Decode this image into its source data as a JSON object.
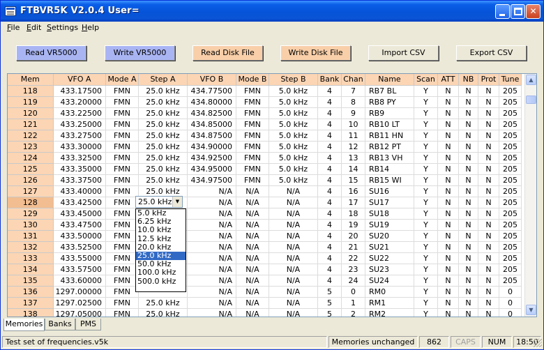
{
  "window": {
    "title": "FTBVR5K V2.0.4    User="
  },
  "menu": [
    {
      "pre": "",
      "u": "F",
      "post": "ile"
    },
    {
      "pre": "",
      "u": "E",
      "post": "dit"
    },
    {
      "pre": "",
      "u": "S",
      "post": "ettings"
    },
    {
      "pre": "",
      "u": "H",
      "post": "elp"
    }
  ],
  "toolbar": {
    "read_vr5000": "Read VR5000",
    "write_vr5000": "Write VR5000",
    "read_disk": "Read Disk File",
    "write_disk": "Write Disk File",
    "import_csv": "Import CSV",
    "export_csv": "Export CSV"
  },
  "grid": {
    "columns": [
      "Mem",
      "VFO A",
      "Mode A",
      "Step A",
      "VFO B",
      "Mode B",
      "Step B",
      "Bank",
      "Chan",
      "Name",
      "Scan",
      "ATT",
      "NB",
      "Prot",
      "Tune"
    ],
    "rows": [
      [
        "118",
        "433.17500",
        "FMN",
        "25.0 kHz",
        "434.77500",
        "FMN",
        "5.0 kHz",
        "4",
        "7",
        "RB7 BL",
        "Y",
        "N",
        "N",
        "N",
        "205"
      ],
      [
        "119",
        "433.20000",
        "FMN",
        "25.0 kHz",
        "434.80000",
        "FMN",
        "5.0 kHz",
        "4",
        "8",
        "RB8 PY",
        "Y",
        "N",
        "N",
        "N",
        "205"
      ],
      [
        "120",
        "433.22500",
        "FMN",
        "25.0 kHz",
        "434.82500",
        "FMN",
        "5.0 kHz",
        "4",
        "9",
        "RB9",
        "Y",
        "N",
        "N",
        "N",
        "205"
      ],
      [
        "121",
        "433.25000",
        "FMN",
        "25.0 kHz",
        "434.85000",
        "FMN",
        "5.0 kHz",
        "4",
        "10",
        "RB10 LT",
        "Y",
        "N",
        "N",
        "N",
        "205"
      ],
      [
        "122",
        "433.27500",
        "FMN",
        "25.0 kHz",
        "434.87500",
        "FMN",
        "5.0 kHz",
        "4",
        "11",
        "RB11 HN",
        "Y",
        "N",
        "N",
        "N",
        "205"
      ],
      [
        "123",
        "433.30000",
        "FMN",
        "25.0 kHz",
        "434.90000",
        "FMN",
        "5.0 kHz",
        "4",
        "12",
        "RB12 PT",
        "Y",
        "N",
        "N",
        "N",
        "205"
      ],
      [
        "124",
        "433.32500",
        "FMN",
        "25.0 kHz",
        "434.92500",
        "FMN",
        "5.0 kHz",
        "4",
        "13",
        "RB13 VH",
        "Y",
        "N",
        "N",
        "N",
        "205"
      ],
      [
        "125",
        "433.35000",
        "FMN",
        "25.0 kHz",
        "434.95000",
        "FMN",
        "5.0 kHz",
        "4",
        "14",
        "RB14",
        "Y",
        "N",
        "N",
        "N",
        "205"
      ],
      [
        "126",
        "433.37500",
        "FMN",
        "25.0 kHz",
        "434.97500",
        "FMN",
        "5.0 kHz",
        "4",
        "15",
        "RB15 WI",
        "Y",
        "N",
        "N",
        "N",
        "205"
      ],
      [
        "127",
        "433.40000",
        "FMN",
        "25.0 kHz",
        "N/A",
        "N/A",
        "N/A",
        "4",
        "16",
        "SU16",
        "Y",
        "N",
        "N",
        "N",
        "205"
      ],
      [
        "128",
        "433.42500",
        "FMN",
        "",
        "N/A",
        "N/A",
        "N/A",
        "4",
        "17",
        "SU17",
        "Y",
        "N",
        "N",
        "N",
        "205"
      ],
      [
        "129",
        "433.45000",
        "FMN",
        "",
        "N/A",
        "N/A",
        "N/A",
        "4",
        "18",
        "SU18",
        "Y",
        "N",
        "N",
        "N",
        "205"
      ],
      [
        "130",
        "433.47500",
        "FMN",
        "",
        "N/A",
        "N/A",
        "N/A",
        "4",
        "19",
        "SU19",
        "Y",
        "N",
        "N",
        "N",
        "205"
      ],
      [
        "131",
        "433.50000",
        "FMN",
        "",
        "N/A",
        "N/A",
        "N/A",
        "4",
        "20",
        "SU20",
        "Y",
        "N",
        "N",
        "N",
        "205"
      ],
      [
        "132",
        "433.52500",
        "FMN",
        "",
        "N/A",
        "N/A",
        "N/A",
        "4",
        "21",
        "SU21",
        "Y",
        "N",
        "N",
        "N",
        "205"
      ],
      [
        "133",
        "433.55000",
        "FMN",
        "",
        "N/A",
        "N/A",
        "N/A",
        "4",
        "22",
        "SU22",
        "Y",
        "N",
        "N",
        "N",
        "205"
      ],
      [
        "134",
        "433.57500",
        "FMN",
        "",
        "N/A",
        "N/A",
        "N/A",
        "4",
        "23",
        "SU23",
        "Y",
        "N",
        "N",
        "N",
        "205"
      ],
      [
        "135",
        "433.60000",
        "FMN",
        "",
        "N/A",
        "N/A",
        "N/A",
        "4",
        "24",
        "SU24",
        "Y",
        "N",
        "N",
        "N",
        "205"
      ],
      [
        "136",
        "1297.00000",
        "FMN",
        "",
        "N/A",
        "N/A",
        "N/A",
        "5",
        "0",
        "RM0",
        "Y",
        "N",
        "N",
        "N",
        "0"
      ],
      [
        "137",
        "1297.02500",
        "FMN",
        "25.0 kHz",
        "N/A",
        "N/A",
        "N/A",
        "5",
        "1",
        "RM1",
        "Y",
        "N",
        "N",
        "N",
        "0"
      ],
      [
        "138",
        "1297.05000",
        "FMN",
        "25.0 kHz",
        "N/A",
        "N/A",
        "N/A",
        "5",
        "2",
        "RM2",
        "Y",
        "N",
        "N",
        "N",
        "0"
      ]
    ]
  },
  "step_combo": {
    "value": "25.0 kHz",
    "options": [
      "5.0 kHz",
      "6.25 kHz",
      "10.0 kHz",
      "12.5 kHz",
      "20.0 kHz",
      "25.0 kHz",
      "50.0 kHz",
      "100.0 kHz",
      "500.0 kHz"
    ],
    "active_index": 5
  },
  "tabs": [
    "Memories",
    "Banks",
    "PMS"
  ],
  "status": {
    "file": "Test set of frequencies.v5k",
    "state": "Memories unchanged",
    "count": "862",
    "caps": "CAPS",
    "num": "NUM",
    "time": "18:50"
  }
}
